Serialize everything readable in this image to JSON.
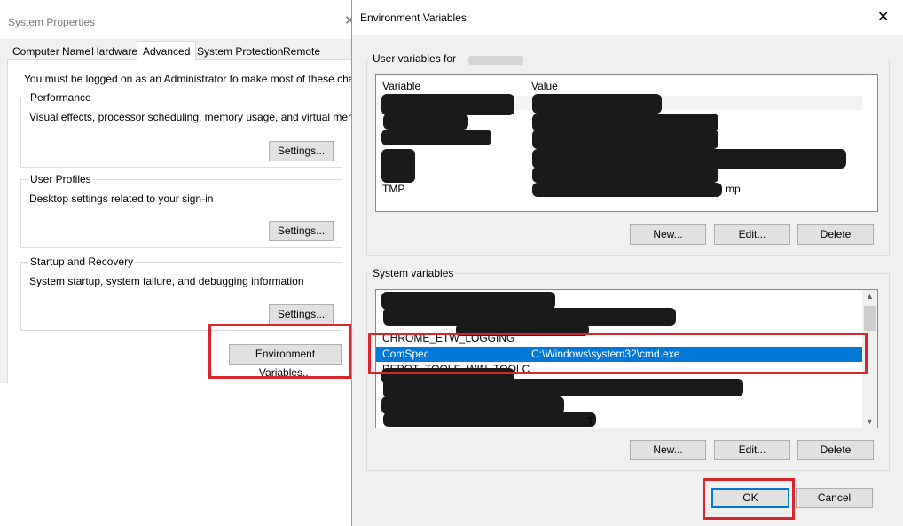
{
  "system_properties": {
    "title": "System Properties",
    "close_glyph": "✕",
    "tabs": [
      {
        "label": "Computer Name"
      },
      {
        "label": "Hardware"
      },
      {
        "label": "Advanced",
        "active": true
      },
      {
        "label": "System Protection"
      },
      {
        "label": "Remote"
      }
    ],
    "notice": "You must be logged on as an Administrator to make most of these changes.",
    "performance": {
      "label": "Performance",
      "description": "Visual effects, processor scheduling, memory usage, and virtual memory",
      "button": "Settings..."
    },
    "user_profiles": {
      "label": "User Profiles",
      "description": "Desktop settings related to your sign-in",
      "button": "Settings..."
    },
    "startup_recovery": {
      "label": "Startup and Recovery",
      "description": "System startup, system failure, and debugging information",
      "button": "Settings..."
    },
    "env_vars_button": "Environment Variables..."
  },
  "env_dialog": {
    "title": "Environment Variables",
    "close_glyph": "✕",
    "user_vars": {
      "label": "User variables for",
      "columns": [
        "Variable",
        "Value"
      ],
      "rows": [
        {
          "name": "TMP",
          "value": "mp"
        }
      ],
      "buttons": {
        "new": "New...",
        "edit": "Edit...",
        "delete": "Delete"
      }
    },
    "system_vars": {
      "label": "System variables",
      "rows": [
        {
          "name": "CHROME_ETW_LOGGING",
          "value": "",
          "selected": false
        },
        {
          "name": "ComSpec",
          "value": "C:\\Windows\\system32\\cmd.exe",
          "selected": true
        },
        {
          "name": "DEPOT_TOOLS_WIN_TOOLC",
          "value": "",
          "selected": false
        }
      ],
      "buttons": {
        "new": "New...",
        "edit": "Edit...",
        "delete": "Delete"
      },
      "trailing_fragment": "T"
    },
    "ok_button": "OK",
    "cancel_button": "Cancel"
  },
  "colors": {
    "highlight_box": "#d9262c",
    "selection": "#0078d7",
    "dialog_bg": "#f0f0f0"
  }
}
